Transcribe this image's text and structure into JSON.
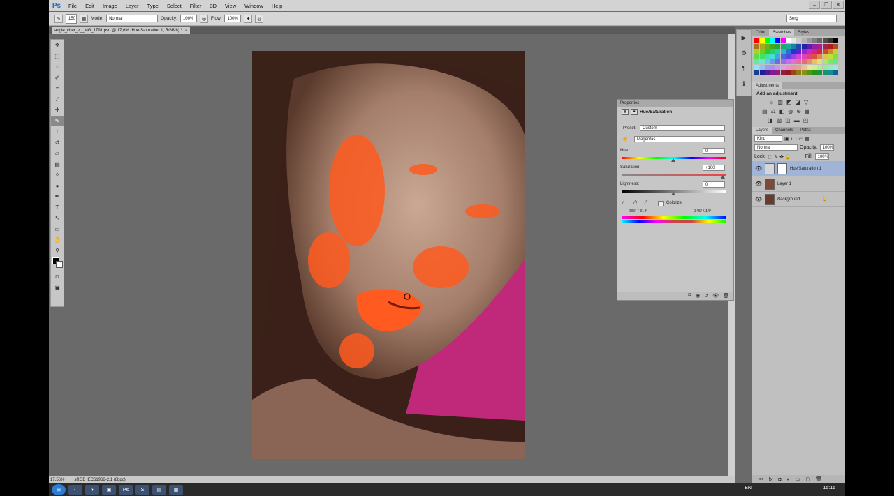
{
  "app": {
    "logo": "Ps"
  },
  "menu": [
    "File",
    "Edit",
    "Image",
    "Layer",
    "Type",
    "Select",
    "Filter",
    "3D",
    "View",
    "Window",
    "Help"
  ],
  "window_controls": [
    "–",
    "❐",
    "✕"
  ],
  "options": {
    "brush_size": "150",
    "mode_label": "Mode:",
    "mode_value": "Normal",
    "opacity_label": "Opacity:",
    "opacity_value": "100%",
    "flow_label": "Flow:",
    "flow_value": "100%",
    "workspace": "Serg"
  },
  "document": {
    "tab_title": "angie_cher_v__MG_1791.psd @ 17,6% (Hue/Saturation 1, RGB/8) *",
    "close": "×"
  },
  "status": {
    "zoom": "17,56%",
    "profile": "sRGB IEC61966-2.1 (8bpc)"
  },
  "properties": {
    "tab": "Properties",
    "title": "Hue/Saturation",
    "preset_label": "Preset:",
    "preset_value": "Custom",
    "channel_value": "Magentas",
    "hue_label": "Hue:",
    "hue_value": "0",
    "saturation_label": "Saturation:",
    "saturation_value": "+100",
    "lightness_label": "Lightness:",
    "lightness_value": "0",
    "colorize_label": "Colorize",
    "range_left": "285° / 314°",
    "range_right": "345° \\ 14°"
  },
  "color_panel": {
    "tabs": [
      "Color",
      "Swatches",
      "Styles"
    ]
  },
  "adjustments": {
    "tab": "Adjustments",
    "title": "Add an adjustment"
  },
  "layers_panel": {
    "tabs": [
      "Layers",
      "Channels",
      "Paths"
    ],
    "kind": "Kind",
    "blend": "Normal",
    "opacity_label": "Opacity:",
    "opacity_value": "100%",
    "lock_label": "Lock:",
    "fill_label": "Fill:",
    "fill_value": "100%",
    "layers": [
      {
        "name": "Hue/Saturation 1",
        "selected": true
      },
      {
        "name": "Layer 1",
        "selected": false
      },
      {
        "name": "Background",
        "selected": false
      }
    ]
  },
  "taskbar": {
    "lang": "EN",
    "time": "15:16"
  },
  "colors": {
    "accent": "#1b6fd0",
    "selection": "#9fb4d6",
    "orange_highlight": "#ff5a1f",
    "magenta_bg": "#c0287a"
  }
}
